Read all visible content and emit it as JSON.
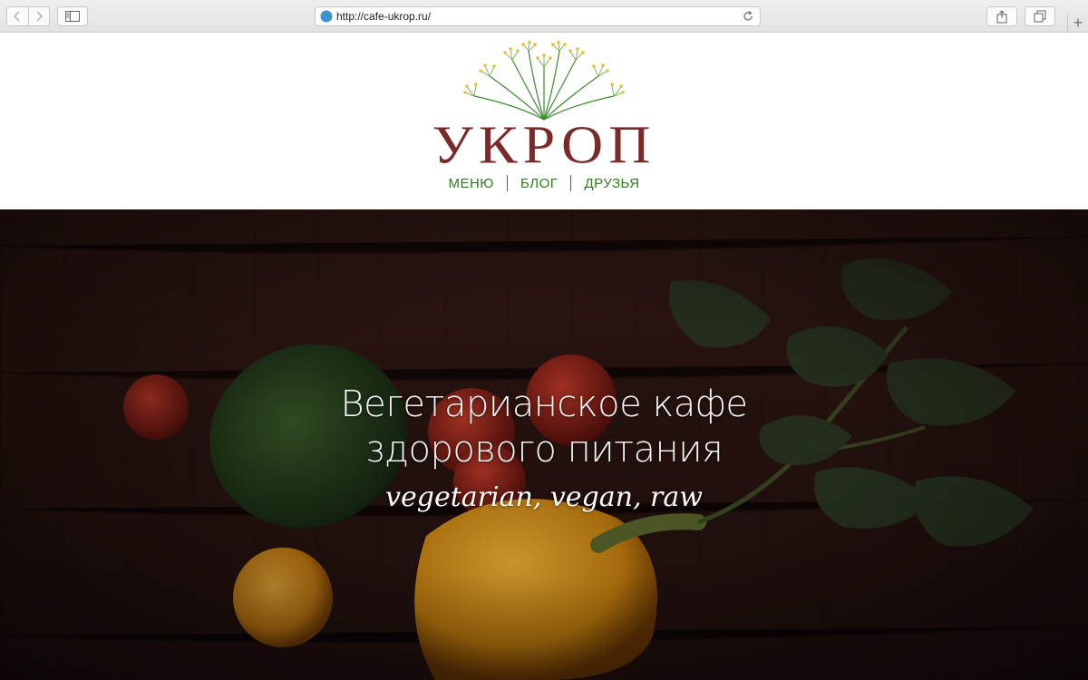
{
  "browser": {
    "url": "http://cafe-ukrop.ru/"
  },
  "site": {
    "logo_text": "УКРОП",
    "nav": [
      {
        "label": "МЕНЮ"
      },
      {
        "label": "БЛОГ"
      },
      {
        "label": "ДРУЗЬЯ"
      }
    ],
    "colors": {
      "logo": "#7b2a2a",
      "nav": "#2f7d1b"
    }
  },
  "hero": {
    "title_line1": "Вегетарианское кафе",
    "title_line2": "здорового питания",
    "tagline": "vegetarian, vegan, raw"
  },
  "icons": [
    "back-icon",
    "forward-icon",
    "sidebar-icon",
    "globe-icon",
    "reload-icon",
    "share-icon",
    "tabs-icon",
    "new-tab-icon",
    "dill-logo-icon"
  ]
}
